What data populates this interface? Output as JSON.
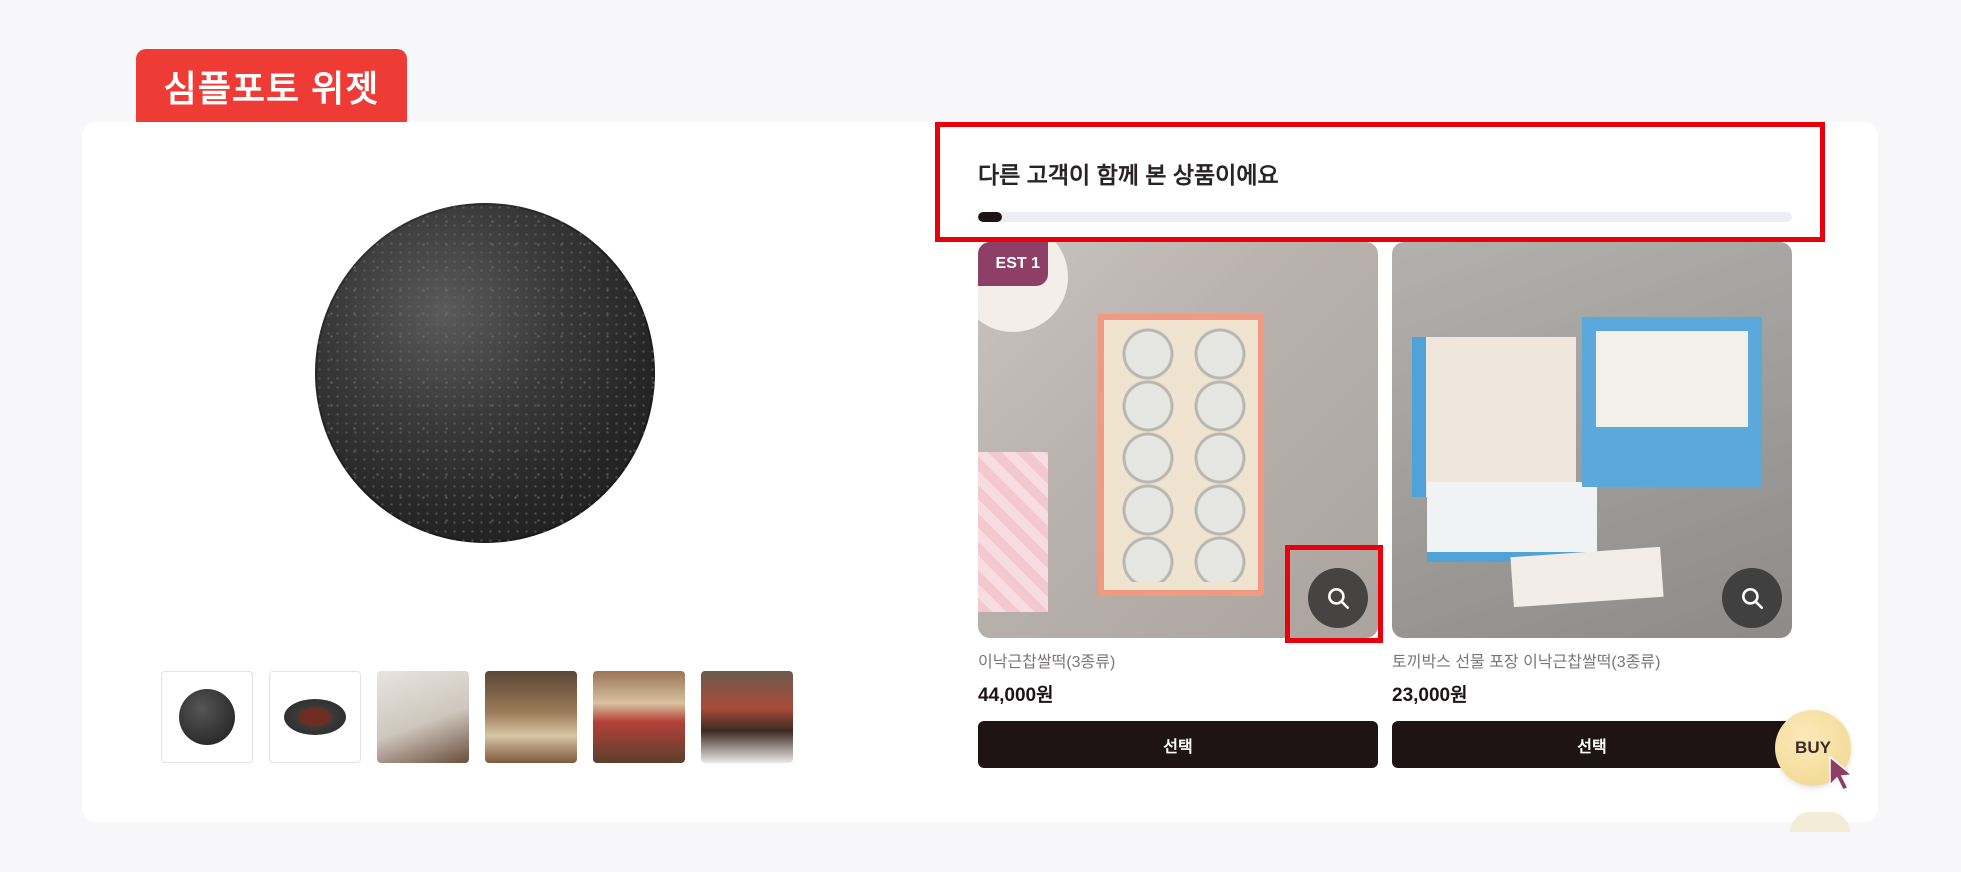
{
  "widget_tag": "심플포토 위젯",
  "recommend": {
    "title": "다른 고객이 함께 본 상품이에요",
    "progress_fraction": 0.03
  },
  "products": [
    {
      "badge": "EST 1",
      "name": "이낙근찹쌀떡(3종류)",
      "price": "44,000원",
      "button": "선택"
    },
    {
      "name": "토끼박스 선물 포장 이낙근찹쌀떡(3종류)",
      "price": "23,000원",
      "button": "선택"
    }
  ],
  "buy_label": "BUY",
  "colors": {
    "accent": "#ef3b36",
    "dark": "#1e1416",
    "highlight": "#e8000b",
    "badge": "#8d3f66"
  },
  "icons": [
    "search-icon",
    "cursor-icon"
  ]
}
